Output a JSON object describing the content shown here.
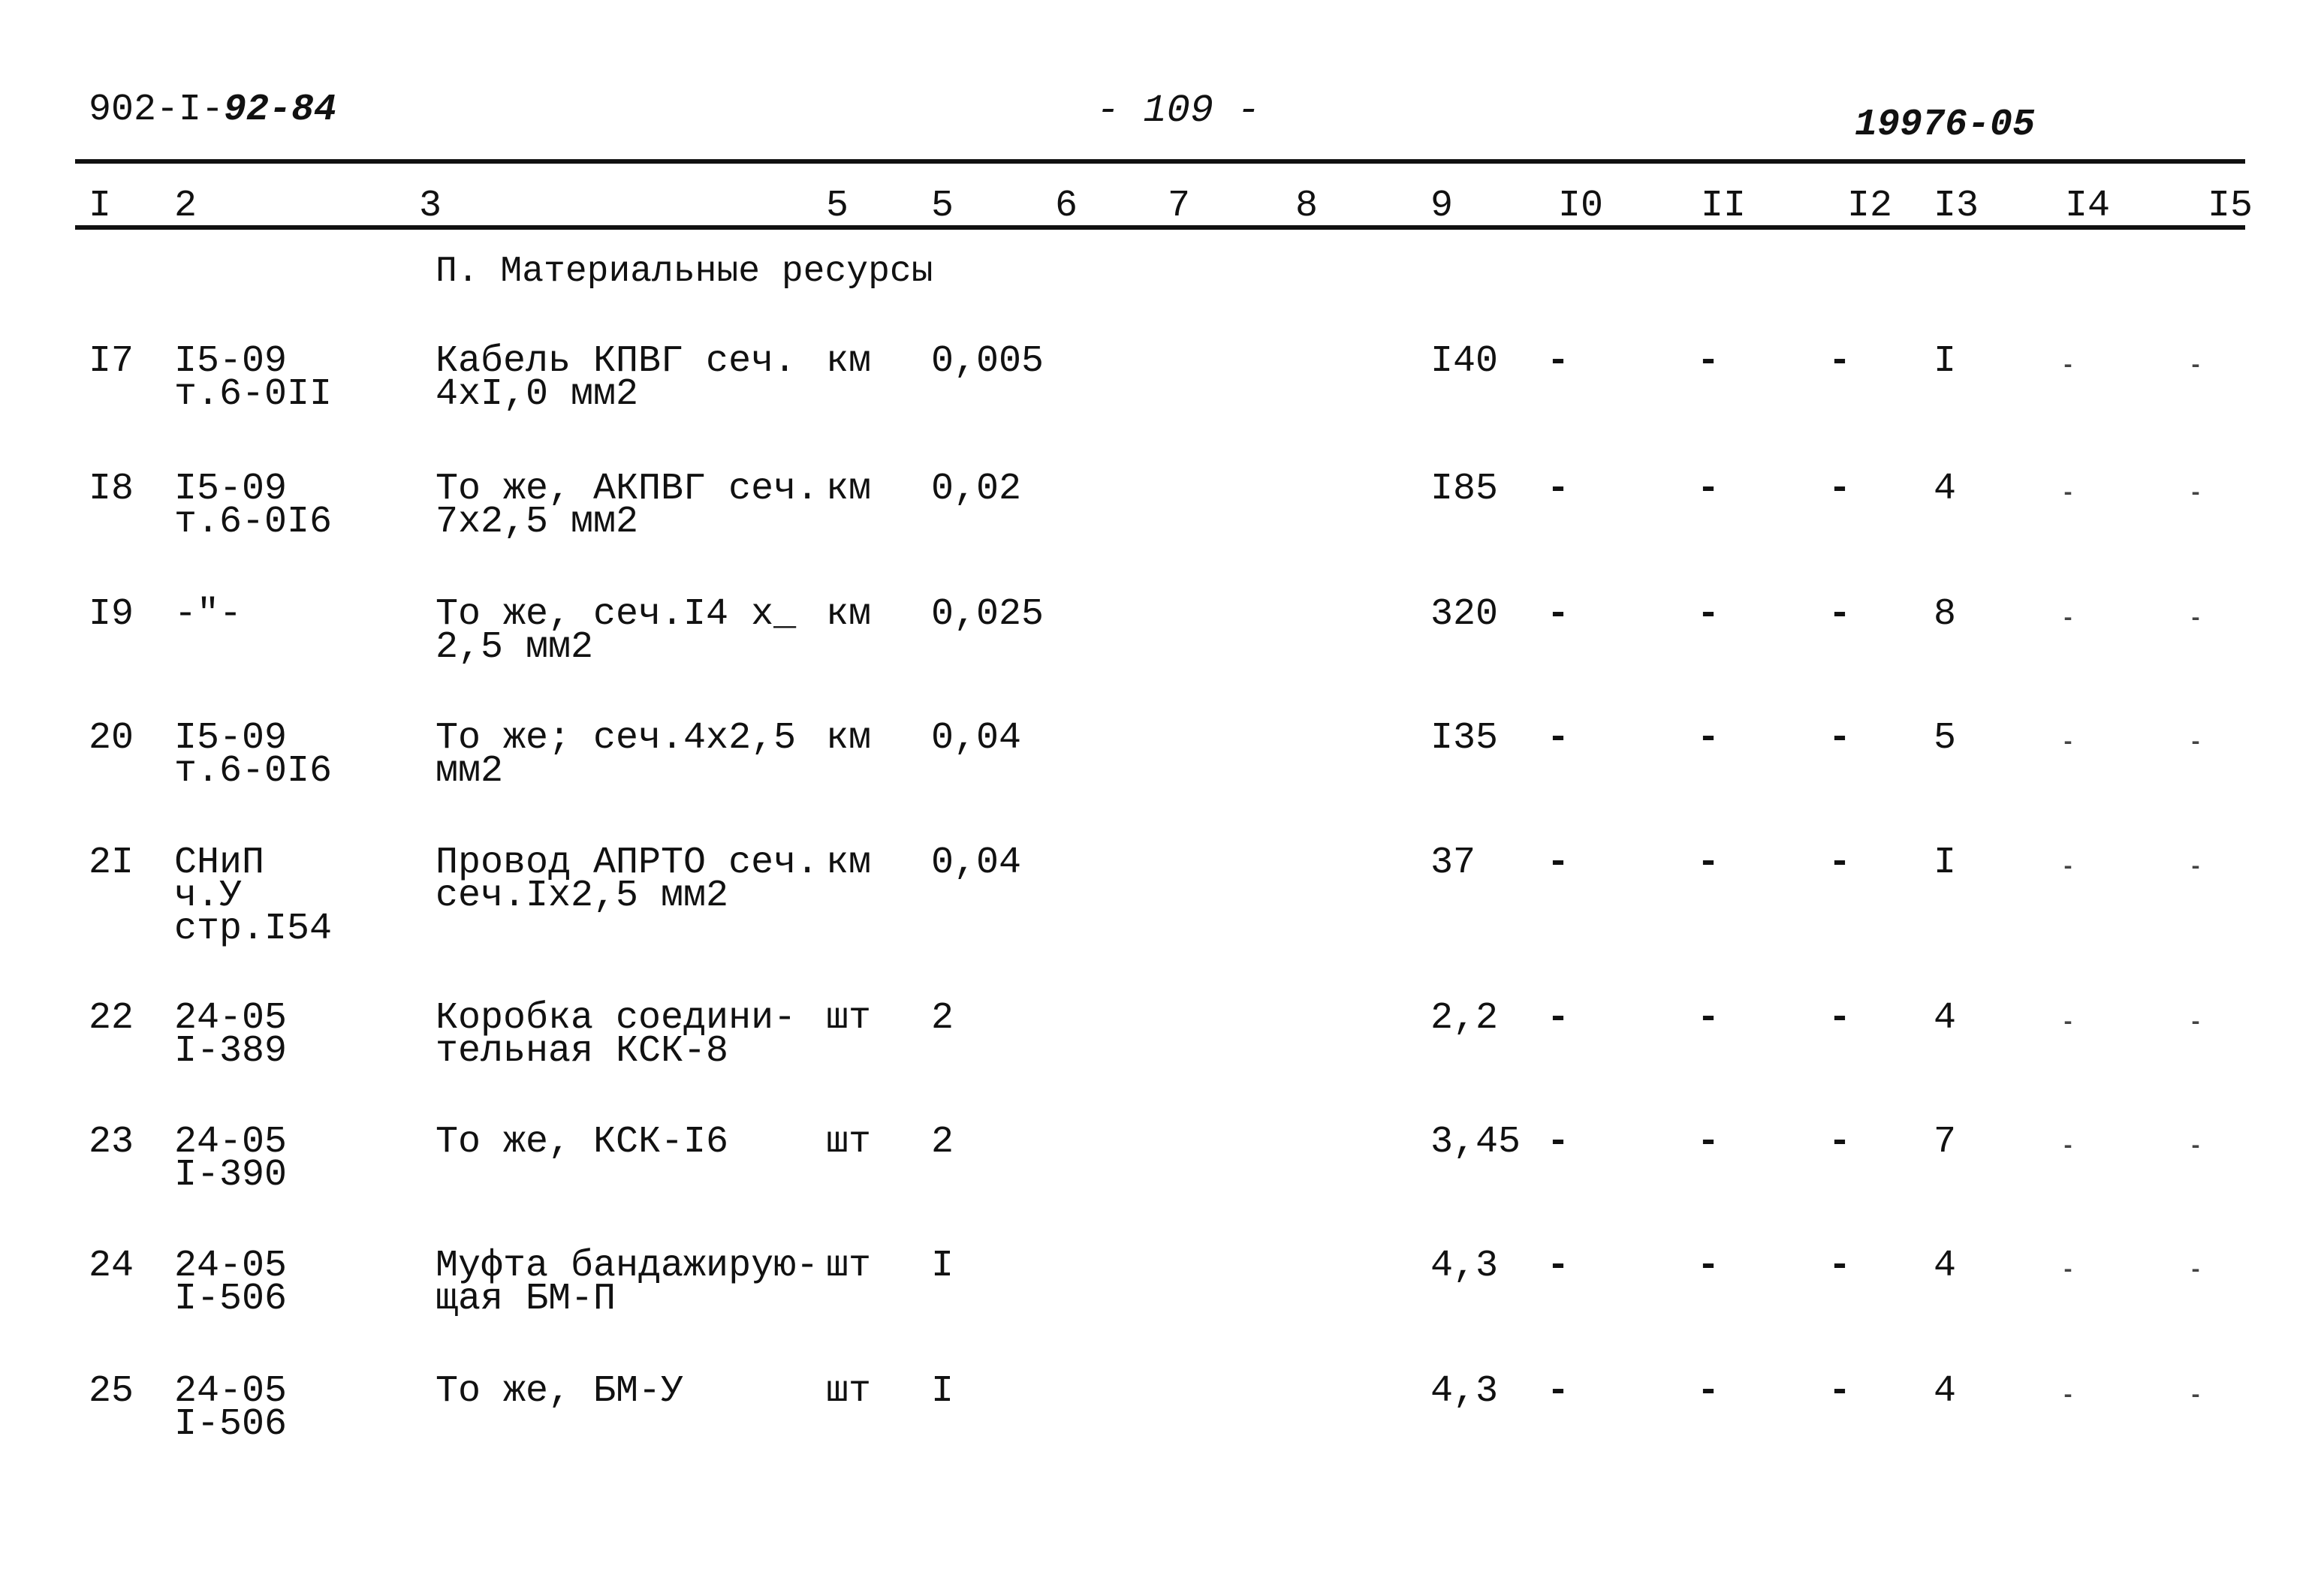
{
  "header": {
    "doc_prefix": "902-I-",
    "doc_suffix": "92-84",
    "page_number": "- 109 -",
    "doc_code": "19976-05"
  },
  "columns": [
    "I",
    "2",
    "3",
    "5",
    "5",
    "6",
    "7",
    "8",
    "9",
    "I0",
    "II",
    "I2",
    "I3",
    "I4",
    "I5"
  ],
  "section_title": "П. Материальные ресурсы",
  "rows": [
    {
      "num": "I7",
      "ref": [
        "I5-09",
        "т.6-0II"
      ],
      "name": [
        "Кабель КПВГ сеч.",
        "4xI,0 мм2"
      ],
      "unit": "км",
      "qty": "0,005",
      "c9": "I40",
      "c10": "-",
      "c11": "-",
      "c12": "-",
      "c13": "I",
      "c14": "-",
      "c15": "-"
    },
    {
      "num": "I8",
      "ref": [
        "I5-09",
        "т.6-0I6"
      ],
      "name": [
        "То же, АКПВГ сеч.",
        "7x2,5 мм2"
      ],
      "unit": "км",
      "qty": "0,02",
      "c9": "I85",
      "c10": "-",
      "c11": "-",
      "c12": "-",
      "c13": "4",
      "c14": "-",
      "c15": "-"
    },
    {
      "num": "I9",
      "ref": [
        "-\"-"
      ],
      "name": [
        "То же, сеч.I4 x_",
        "2,5 мм2"
      ],
      "unit": "км",
      "qty": "0,025",
      "c9": "320",
      "c10": "-",
      "c11": "-",
      "c12": "-",
      "c13": "8",
      "c14": "-",
      "c15": "-"
    },
    {
      "num": "20",
      "ref": [
        "I5-09",
        "т.6-0I6"
      ],
      "name": [
        "То же; сеч.4x2,5",
        "мм2"
      ],
      "unit": "км",
      "qty": "0,04",
      "c9": "I35",
      "c10": "-",
      "c11": "-",
      "c12": "-",
      "c13": "5",
      "c14": "-",
      "c15": "-"
    },
    {
      "num": "2I",
      "ref": [
        "СНиП",
        "ч.У",
        "стр.I54"
      ],
      "name": [
        "Провод АПРТО сеч.",
        "сеч.Ix2,5 мм2"
      ],
      "unit": "км",
      "qty": "0,04",
      "c9": "37",
      "c10": "-",
      "c11": "-",
      "c12": "-",
      "c13": "I",
      "c14": "-",
      "c15": "-"
    },
    {
      "num": "22",
      "ref": [
        "24-05",
        "I-389"
      ],
      "name": [
        "Коробка соедини-",
        "тельная КСК-8"
      ],
      "unit": "шт",
      "qty": "2",
      "c9": "2,2",
      "c10": "-",
      "c11": "-",
      "c12": "-",
      "c13": "4",
      "c14": "-",
      "c15": "-"
    },
    {
      "num": "23",
      "ref": [
        "24-05",
        "I-390"
      ],
      "name": [
        "То же, КСК-I6"
      ],
      "unit": "шт",
      "qty": "2",
      "c9": "3,45",
      "c10": "-",
      "c11": "-",
      "c12": "-",
      "c13": "7",
      "c14": "-",
      "c15": "-"
    },
    {
      "num": "24",
      "ref": [
        "24-05",
        "I-506"
      ],
      "name": [
        "Муфта бандажирую-",
        "щая БМ-П"
      ],
      "unit": "шт",
      "qty": "I",
      "c9": "4,3",
      "c10": "-",
      "c11": "-",
      "c12": "-",
      "c13": "4",
      "c14": "-",
      "c15": "-"
    },
    {
      "num": "25",
      "ref": [
        "24-05",
        "I-506"
      ],
      "name": [
        "То же, БМ-У"
      ],
      "unit": "шт",
      "qty": "I",
      "c9": "4,3",
      "c10": "-",
      "c11": "-",
      "c12": "-",
      "c13": "4",
      "c14": "-",
      "c15": "-"
    }
  ]
}
